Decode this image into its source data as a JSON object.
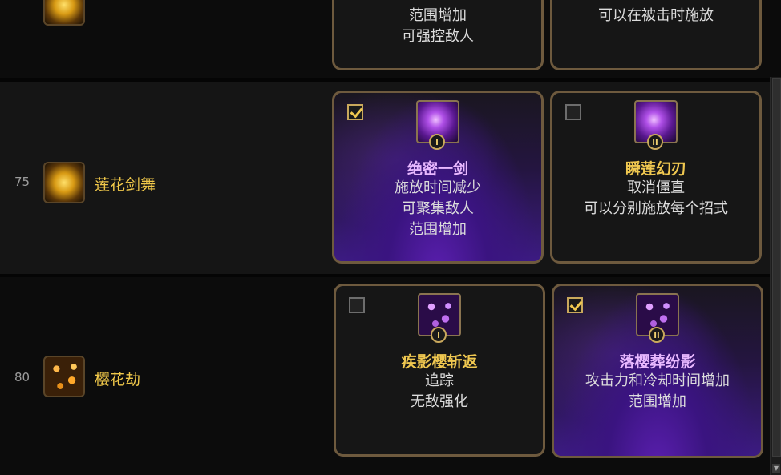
{
  "rows": [
    {
      "level": "",
      "name": "",
      "options": [
        {
          "selected": false,
          "name": "",
          "desc": [
            "范围增加",
            "可强控敌人"
          ]
        },
        {
          "selected": false,
          "name": "",
          "desc": [
            "可以在被击时施放"
          ]
        }
      ]
    },
    {
      "level": "75",
      "name": "莲花剑舞",
      "icon": "lotus-sword-dance-icon",
      "options": [
        {
          "selected": true,
          "roman": "I",
          "name": "绝密一剑",
          "icon": "purple-swirl-icon",
          "desc": [
            "施放时间减少",
            "可聚集敌人",
            "范围增加"
          ]
        },
        {
          "selected": false,
          "roman": "II",
          "name": "瞬莲幻刃",
          "icon": "purple-swirl-icon",
          "desc": [
            "取消僵直",
            "可以分别施放每个招式"
          ]
        }
      ]
    },
    {
      "level": "80",
      "name": "樱花劫",
      "icon": "sakura-petals-icon",
      "options": [
        {
          "selected": false,
          "roman": "I",
          "name": "疾影樱斩返",
          "icon": "sakura-slash-icon",
          "desc": [
            "追踪",
            "无敌强化"
          ]
        },
        {
          "selected": true,
          "roman": "II",
          "name": "落樱葬纷影",
          "icon": "sakura-slash-icon",
          "desc": [
            "攻击力和冷却时间增加",
            "范围增加"
          ]
        }
      ]
    }
  ],
  "colors": {
    "accent_gold": "#f0c850",
    "selected_purple": "#3c1b82",
    "card_border": "#6e5a3e"
  }
}
